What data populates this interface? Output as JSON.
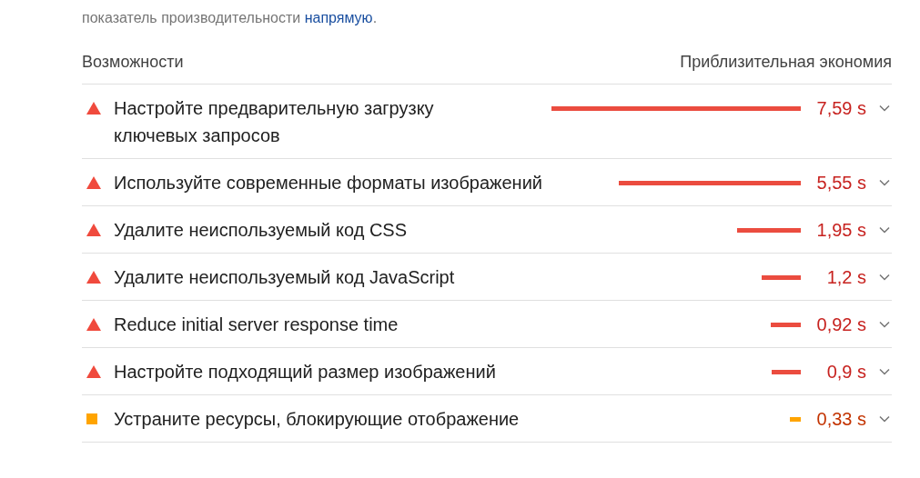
{
  "intro": {
    "text": "показатель производительности ",
    "link": "напрямую",
    "tail": "."
  },
  "header": {
    "left": "Возможности",
    "right": "Приблизительная экономия"
  },
  "opportunities": [
    {
      "kind": "fail",
      "title": "Настройте предварительную загрузку ключевых запросов",
      "savings": "7,59 s",
      "expanded": false
    },
    {
      "kind": "fail",
      "title": "Используйте современные форматы изображений",
      "savings": "5,55 s",
      "expanded": false
    },
    {
      "kind": "fail",
      "title": "Удалите неиспользуемый код CSS",
      "savings": "1,95 s",
      "expanded": false
    },
    {
      "kind": "fail",
      "title": "Удалите неиспользуемый код JavaScript",
      "savings": "1,2 s",
      "expanded": false
    },
    {
      "kind": "fail",
      "title": "Reduce initial server response time",
      "savings": "0,92 s",
      "expanded": false
    },
    {
      "kind": "fail",
      "title": "Настройте подходящий размер изображений",
      "savings": "0,9 s",
      "expanded": false
    },
    {
      "kind": "average",
      "title": "Устраните ресурсы, блокирующие отображение",
      "savings": "0,33 s",
      "expanded": false
    }
  ]
}
